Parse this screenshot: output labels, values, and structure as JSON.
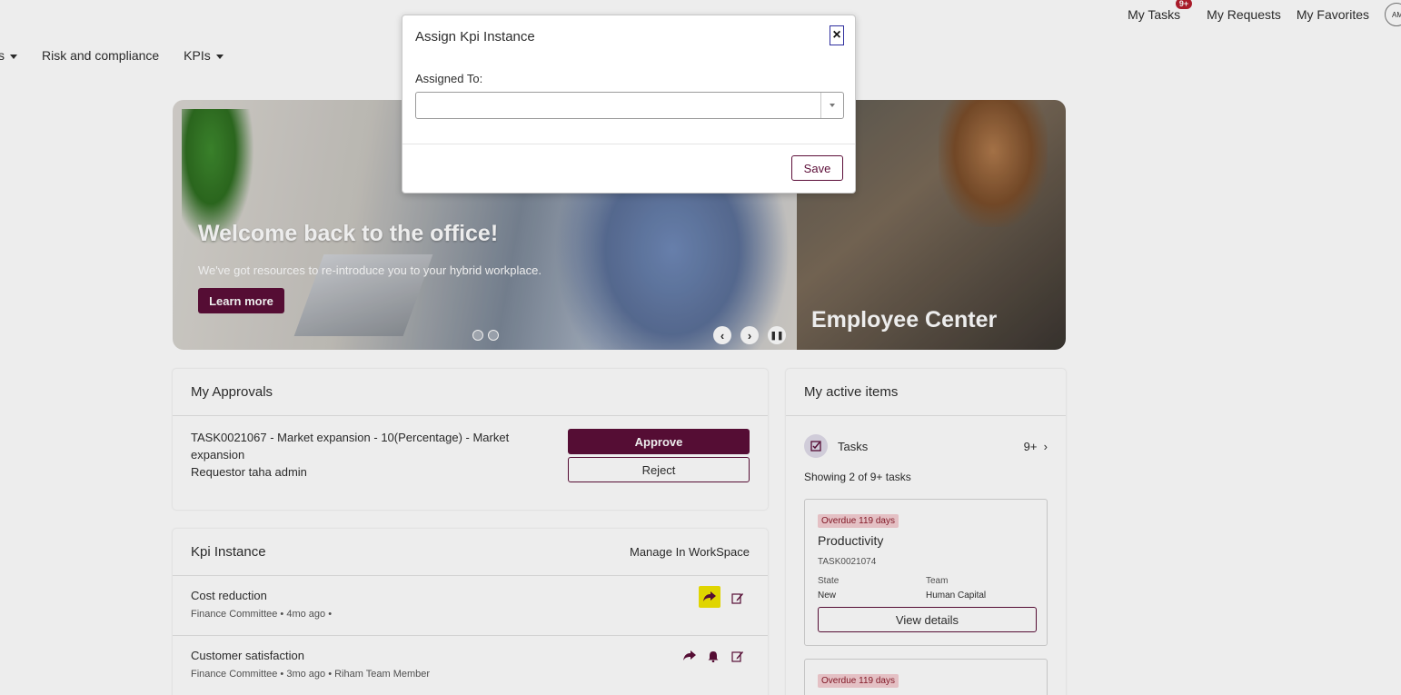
{
  "header": {
    "my_tasks": "My Tasks",
    "tasks_badge": "9+",
    "my_requests": "My Requests",
    "my_favorites": "My Favorites",
    "avatar_initials": "AM"
  },
  "nav": {
    "items": [
      {
        "label": "s"
      },
      {
        "label": "Risk and compliance"
      },
      {
        "label": "KPIs"
      }
    ]
  },
  "hero": {
    "title": "Welcome back to the office!",
    "subtitle": "We've got resources to re-introduce you to your hybrid workplace.",
    "cta": "Learn more",
    "side_title": "Employee Center"
  },
  "approvals": {
    "title": "My Approvals",
    "item_text": "TASK0021067 - Market expansion - 10(Percentage) - Market expansion",
    "requestor": "Requestor taha admin",
    "approve": "Approve",
    "reject": "Reject"
  },
  "kpi": {
    "title": "Kpi Instance",
    "manage": "Manage In WorkSpace",
    "rows": [
      {
        "title": "Cost reduction",
        "meta": "Finance Committee • 4mo ago •"
      },
      {
        "title": "Customer satisfaction",
        "meta": "Finance Committee • 3mo ago • Riham Team Member"
      }
    ]
  },
  "active": {
    "title": "My active items",
    "tasks_label": "Tasks",
    "tasks_count": "9+",
    "showing": "Showing 2 of 9+ tasks",
    "card1": {
      "overdue": "Overdue 119 days",
      "title": "Productivity",
      "number": "TASK0021074",
      "state_label": "State",
      "team_label": "Team",
      "state": "New",
      "team": "Human Capital",
      "view": "View details"
    },
    "card2": {
      "overdue": "Overdue 119 days"
    }
  },
  "modal": {
    "title": "Assign Kpi Instance",
    "close": "×",
    "field_label": "Assigned To:",
    "field_value": "",
    "save": "Save"
  },
  "colors": {
    "brand": "#5c0e38",
    "overdue_bg": "#f6cfd3",
    "badge": "#b51e2d"
  }
}
